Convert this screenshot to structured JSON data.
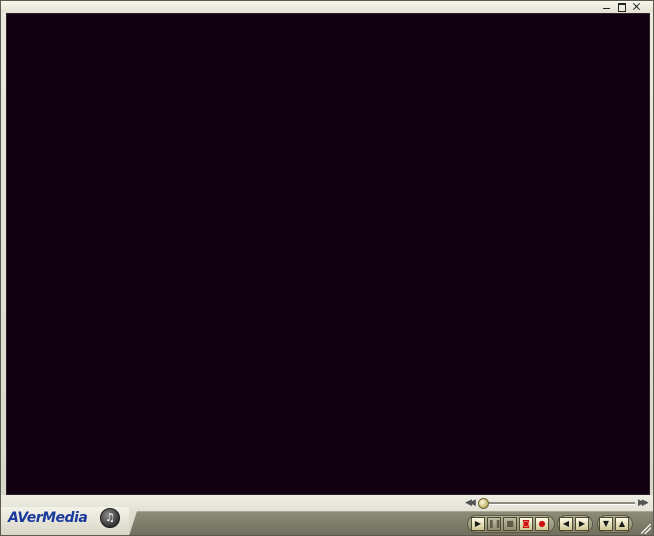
{
  "window": {
    "minimize_icon": "minimize-icon",
    "maximize_icon": "maximize-icon",
    "close_icon": "close-icon"
  },
  "brand": {
    "logo_text": "AVerMedia",
    "logo_color": "#1a3b9c"
  },
  "video": {
    "background_color": "#110010"
  },
  "seek": {
    "rewind_icon": "rewind-icon",
    "forward_icon": "fast-forward-icon",
    "position_fraction": 0.0
  },
  "controls": {
    "audio_icon": "audio-icon",
    "play_icon": "play-icon",
    "pause_icon": "pause-icon",
    "stop_icon": "stop-icon",
    "snapshot_icon": "snapshot-icon",
    "record_icon": "record-icon",
    "prev_channel_icon": "previous-channel-icon",
    "next_channel_icon": "next-channel-icon",
    "volume_down_icon": "volume-down-icon",
    "volume_up_icon": "volume-up-icon",
    "play_symbol": "▶",
    "pause_symbol": "❚❚",
    "stop_symbol": "■",
    "snapshot_symbol": "◙",
    "record_symbol": "●",
    "prev_symbol": "◀",
    "next_symbol": "▶",
    "down_symbol": "▼",
    "up_symbol": "▲",
    "audio_symbol": "♫"
  }
}
